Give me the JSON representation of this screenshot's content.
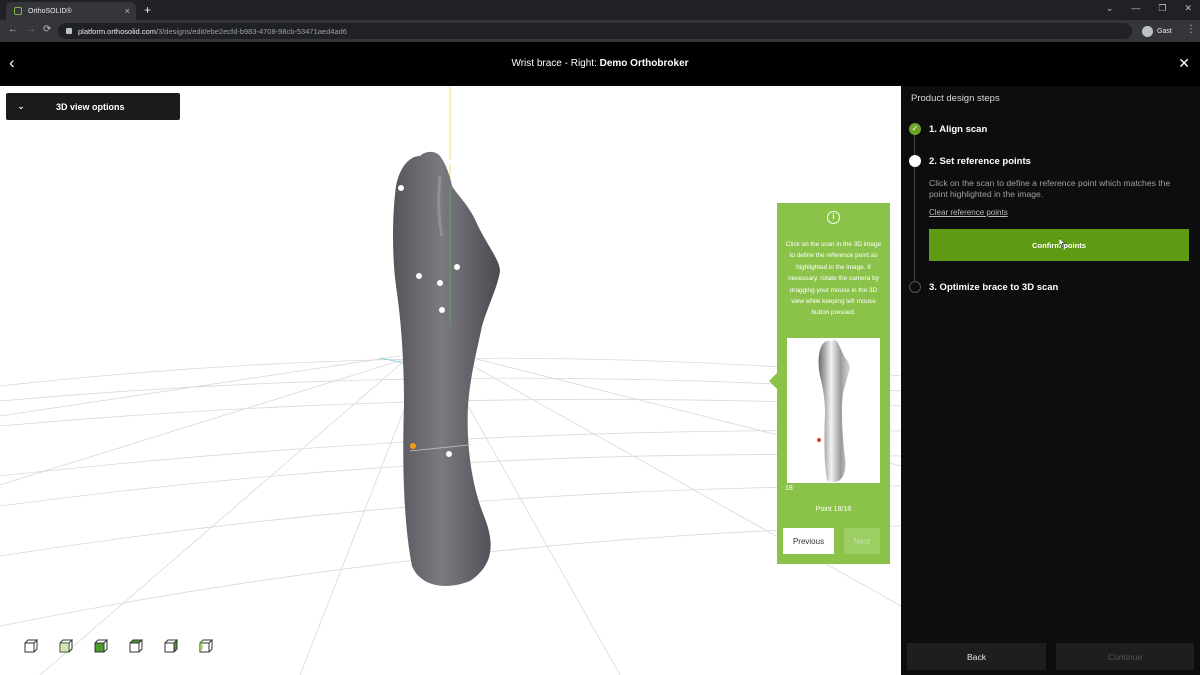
{
  "browser": {
    "tab_title": "OrthoSOLID®",
    "tab_close": "×",
    "new_tab": "+",
    "url_host": "platform.orthosolid.com",
    "url_path": "/3/designs/edit/ebe2ecfd-b983-4708-98cb-53471aed4ad6",
    "profile_name": "Gast"
  },
  "header": {
    "title_prefix": "Wrist brace - Right: ",
    "title_bold": "Demo Orthobroker"
  },
  "viewport": {
    "view_options_label": "3D view options",
    "view_cube_icons": [
      "cube-view-1",
      "cube-view-2",
      "cube-view-3",
      "cube-view-4",
      "cube-view-5",
      "cube-view-6"
    ]
  },
  "hint_card": {
    "text": "Click on the scan in the 3D image to define the reference point as highlighted in the image. If necessary, rotate the camera by dragging your mouse in the 3D view while keeping left mouse button pressed.",
    "thumb_number": "18",
    "point_label": "Point 18/18",
    "previous_label": "Previous",
    "next_label": "Next"
  },
  "panel": {
    "title": "Product design steps",
    "steps": [
      {
        "label": "1. Align scan",
        "status": "done"
      },
      {
        "label": "2. Set reference points",
        "status": "active"
      },
      {
        "label": "3. Optimize brace to 3D scan",
        "status": "todo"
      }
    ],
    "step2_description": "Click on the scan to define a reference point which matches the point highlighted in the image.",
    "clear_link": "Clear reference points",
    "confirm_label": "Confirm points",
    "back_label": "Back",
    "continue_label": "Continue"
  },
  "colors": {
    "accent_green": "#5e9a12",
    "card_green": "#8bc34a",
    "panel_bg": "#0d0d0d"
  }
}
